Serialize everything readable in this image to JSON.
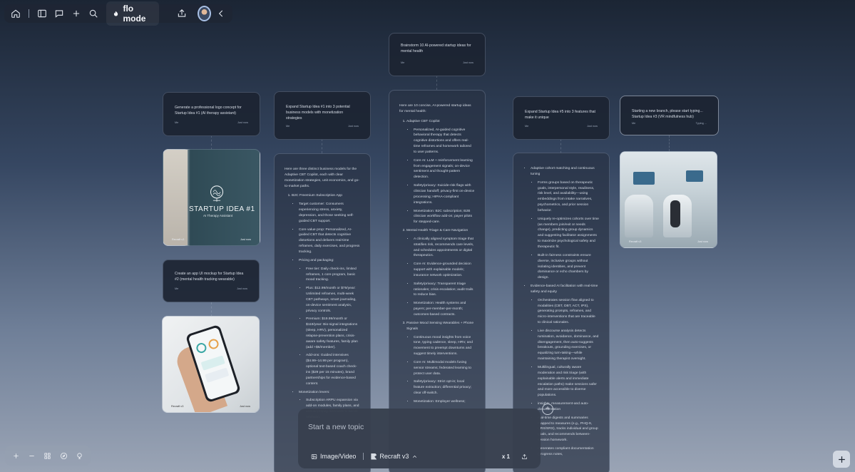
{
  "toolbar": {
    "mode_label": "flo mode",
    "icons": [
      "home-icon",
      "sidebar-icon",
      "chat-icon",
      "plus-icon",
      "search-icon",
      "share-icon",
      "chevron-left-icon"
    ]
  },
  "cards": {
    "top": {
      "prompt": "Brainstorm 10 AI-powered startup ideas for mental health",
      "author": "Me",
      "time": "Just now"
    },
    "logo": {
      "prompt": "Generate a professional logo concept for Startup Idea #1 (AI therapy assistant)",
      "author": "Me",
      "time": "Just now"
    },
    "expand1": {
      "prompt": "Expand Startup Idea #1 into 3 potential business models with monetization strategies",
      "author": "Me",
      "time": "Just now"
    },
    "expand5": {
      "prompt": "Expand Startup Idea #5 into 3 features that make it unique",
      "author": "Me",
      "time": "Just now"
    },
    "branch": {
      "prompt": "Starting a new branch, please start typing... Startup Idea #3 (VR mindfulness hub)",
      "author": "Me",
      "typing": "Typing ..."
    },
    "mockup": {
      "prompt": "Create an app UI mockup for Startup Idea #2 (mental health tracking wearable)",
      "author": "Me",
      "time": "Just now"
    }
  },
  "images": {
    "logo_image": {
      "title": "STARTUP IDEA #1",
      "subtitle": "AI Therapy Assistant",
      "author": "Recraft v3",
      "time": "Just now"
    },
    "vr_image": {
      "author": "Recraft v3",
      "time": "Just now"
    },
    "app_image": {
      "author": "Recraft v3",
      "time": "Just now"
    }
  },
  "responses": {
    "business": {
      "intro": "Here are three distinct business models for the Adaptive CBT Copilot, each with clear monetization strategies, unit economics, and go-to-market paths.",
      "h1": "B2C Freemium Subscription App",
      "items": [
        "Target customer: Consumers experiencing stress, anxiety, depression, and those seeking self-guided CBT support.",
        "Core value prop: Personalized, AI-guided CBT that detects cognitive distortions and delivers real-time reframes, daily exercises, and progress tracking.",
        "Pricing and packaging:",
        "Free tier: Daily check-ins, limited reframes, 1 core program, basic mood tracking.",
        "Plus: $12.99/month or $79/year: Unlimited reframes, multi-week CBT pathways, smart journaling, on-device sentiment analysis, privacy controls.",
        "Premium: $19.99/month or $119/year: Bio-signal integrations (sleep, HRV), personalized relapse-prevention plans, crisis-aware safety features, family plan (add +$6/member).",
        "Add-ons: Guided intensives ($4.99–14.99 per program), optional text-based coach check-ins ($29 per 15 minutes), brand partnerships for evidence-based content.",
        "Monetization levers:",
        "Subscription ARPU expansion via add-on modules, family plans, and annual prepay discounts to boost retention."
      ]
    },
    "ideas": {
      "intro": "Here are 10 concise, AI-powered startup ideas for mental health:",
      "h1": "Adaptive CBT Copilot",
      "items1": [
        "Personalized, AI-guided cognitive behavioral therapy that detects cognitive distortions and offers real-time reframes and homework tailored to user patterns.",
        "Core AI: LLM + reinforcement learning from engagement signals; on-device sentiment and thought-pattern detection.",
        "Safety/privacy: Suicide-risk flags with clinician handoff; privacy-first on-device processing; HIPAA-compliant integrations.",
        "Monetization: B2C subscription; B2B clinician workflow add-on; payer pilots for stepped-care."
      ],
      "h2": "Mental Health Triage & Care Navigation",
      "items2": [
        "A clinically aligned symptom triage that stratifies risk, recommends care levels, and schedules appointments or digital therapeutics.",
        "Core AI: Evidence-grounded decision support with explainable models; insurance network optimization.",
        "Safety/privacy: Transparent triage rationales; crisis escalation; audit trails to reduce bias.",
        "Monetization: Health systems and payers; per-member-per-month; outcomes-based contracts."
      ],
      "h3": "Passive Mood Sensing Wearables + Phone Signals",
      "items3": [
        "Continuous mood insights from voice tone, typing cadence, sleep, HRV, and movement to preempt downturns and suggest timely interventions.",
        "Core AI: Multimodal models fusing sensor streams; federated learning to protect user data.",
        "Safety/privacy: Strict opt-in; local feature extraction; differential privacy; clear off-switch.",
        "Monetization: Employer wellness;"
      ]
    },
    "features": {
      "h1": "Adaptive cohort matching and continuous tuning",
      "items1": [
        "Forms groups based on therapeutic goals, interpersonal style, readiness, risk level, and availability—using embeddings from intake narratives, psychometrics, and prior session behavior.",
        "Uniquely re-optimizes cohorts over time (as members join/exit or needs change), predicting group dynamics and suggesting facilitator assignments to maximize psychological safety and therapeutic fit.",
        "Built-in fairness constraints ensure diverse, inclusive groups without isolating identities, and prevent dominance or echo chambers by design."
      ],
      "h2": "Evidence-based AI facilitation with real-time safety and equity",
      "items2": [
        "Orchestrates session flow aligned to modalities (CBT, DBT, ACT, IPS), generating prompts, reframes, and micro-interventions that are traceable to clinical rationales.",
        "Live discourse analysis detects rumination, avoidance, dominance, and disengagement, then auto-suggests breakouts, grounding exercises, or equalizing turn-taking—while maintaining therapist oversight.",
        "Multilingual, culturally aware moderation and risk triage (with explainable alerts and immediate escalation paths) make sessions safer and more accessible to diverse populations.",
        "insights, measurement-and auto-documentation",
        "real-time digests and summaries mapped to measures (e.g., PHQ-9, ORS/SRS), tracks individual and group goals, and recommends between-session homework.",
        "Generates compliant documentation (progress notes,"
      ]
    }
  },
  "composer": {
    "placeholder": "Start a new topic",
    "image_video_label": "Image/Video",
    "model_label": "Recraft v3",
    "multiplier": "x 1"
  },
  "zoom_bar": {
    "icons": [
      "zoom-in-icon",
      "zoom-out-icon",
      "grid-icon",
      "compass-icon",
      "pin-icon"
    ]
  }
}
